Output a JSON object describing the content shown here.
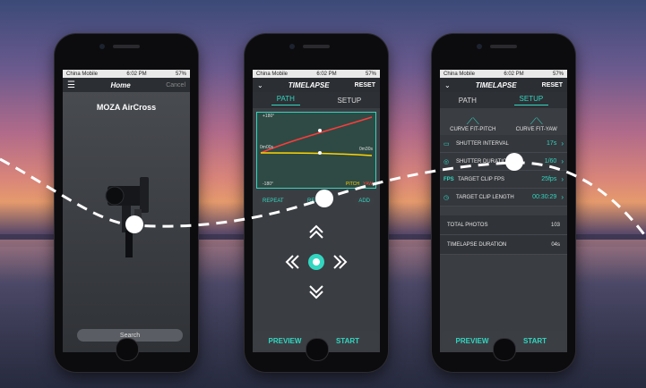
{
  "status": {
    "carrier": "China Mobile",
    "time": "6:02 PM",
    "battery": "57%"
  },
  "phone1": {
    "nav_title": "Home",
    "nav_right": "Cancel",
    "device_name": "MOZA AirCross",
    "search_label": "Search"
  },
  "phone2": {
    "nav_title": "TIMELAPSE",
    "nav_right": "RESET",
    "tabs": [
      "PATH",
      "SETUP"
    ],
    "chart_top": "+180°",
    "chart_mid": "0m00s",
    "chart_mid_right": "0m30s",
    "chart_bottom": "-180°",
    "legend_pitch": "PITCH",
    "legend_yaw": "YAW",
    "repeat_label": "REPEAT",
    "remove_label": "REMOVE",
    "add_label": "ADD",
    "preview_label": "PREVIEW",
    "start_label": "START"
  },
  "phone3": {
    "nav_title": "TIMELAPSE",
    "nav_right": "RESET",
    "tabs": [
      "PATH",
      "SETUP"
    ],
    "curve_pitch": "CURVE FIT-PITCH",
    "curve_yaw": "CURVE FIT-YAW",
    "settings": [
      {
        "label": "SHUTTER INTERVAL",
        "value": "17s",
        "icon": "shutter-interval-icon"
      },
      {
        "label": "SHUTTER DURATION",
        "value": "1/60",
        "icon": "shutter-duration-icon"
      },
      {
        "label": "TARGET CLIP FPS",
        "value": "25fps",
        "icon": "fps-icon"
      },
      {
        "label": "TARGET CLIP LENGTH",
        "value": "00:30:29",
        "icon": "clock-icon"
      }
    ],
    "fps_badge": "FPS",
    "totals": [
      {
        "label": "TOTAL PHOTOS",
        "value": "103"
      },
      {
        "label": "TIMELAPSE DURATION",
        "value": "04s"
      }
    ],
    "preview_label": "PREVIEW",
    "start_label": "START"
  },
  "colors": {
    "accent": "#33d6c0",
    "pitch_line": "#ff3b3b",
    "yaw_line": "#ffd400"
  }
}
